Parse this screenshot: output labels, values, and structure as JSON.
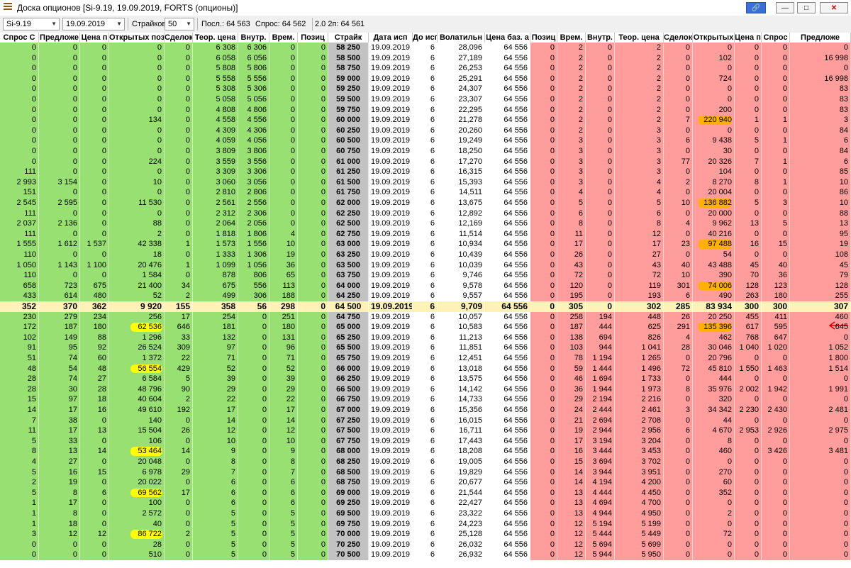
{
  "window": {
    "title": "Доска опционов [Si-9.19, 19.09.2019, FORTS (опционы)]"
  },
  "toolbar": {
    "instrument": "Si-9.19",
    "date": "19.09.2019",
    "strikes_label": "Страйков:",
    "strikes_value": "50",
    "last_label": "Посл.: 64 563",
    "bid_label": "Спрос: 64 562",
    "ask_label": "2.0 2п: 64 561"
  },
  "columns": [
    "Спрос С",
    "Предложе",
    "Цена п",
    "Открытых поз",
    "Сделок",
    "Теор. цена",
    "Внутр.",
    "Врем.",
    "Позиц",
    "Страйк",
    "Дата исп",
    "До исп",
    "Волатильн",
    "Цена баз. а",
    "Позиц",
    "Врем.",
    "Внутр.",
    "Теор. цена",
    "Сделок",
    "Открытых",
    "Цена п",
    "Спрос",
    "Предложе"
  ],
  "rows": [
    [
      "0",
      "0",
      "0",
      "0",
      "0",
      "6 308",
      "6 306",
      "0",
      "0",
      "58 250",
      "19.09.2019",
      "6",
      "28,096",
      "64 556",
      "0",
      "2",
      "0",
      "2",
      "0",
      "0",
      "0",
      "0",
      "0"
    ],
    [
      "0",
      "0",
      "0",
      "0",
      "0",
      "6 058",
      "6 056",
      "0",
      "0",
      "58 500",
      "19.09.2019",
      "6",
      "27,189",
      "64 556",
      "0",
      "2",
      "0",
      "2",
      "0",
      "102",
      "0",
      "0",
      "16 998"
    ],
    [
      "0",
      "0",
      "0",
      "0",
      "0",
      "5 808",
      "5 806",
      "0",
      "0",
      "58 750",
      "19.09.2019",
      "6",
      "26,253",
      "64 556",
      "0",
      "2",
      "0",
      "2",
      "0",
      "0",
      "0",
      "0",
      "0"
    ],
    [
      "0",
      "0",
      "0",
      "0",
      "0",
      "5 558",
      "5 556",
      "0",
      "0",
      "59 000",
      "19.09.2019",
      "6",
      "25,291",
      "64 556",
      "0",
      "2",
      "0",
      "2",
      "0",
      "724",
      "0",
      "0",
      "16 998"
    ],
    [
      "0",
      "0",
      "0",
      "0",
      "0",
      "5 308",
      "5 306",
      "0",
      "0",
      "59 250",
      "19.09.2019",
      "6",
      "24,307",
      "64 556",
      "0",
      "2",
      "0",
      "2",
      "0",
      "0",
      "0",
      "0",
      "83"
    ],
    [
      "0",
      "0",
      "0",
      "0",
      "0",
      "5 058",
      "5 056",
      "0",
      "0",
      "59 500",
      "19.09.2019",
      "6",
      "23,307",
      "64 556",
      "0",
      "2",
      "0",
      "2",
      "0",
      "0",
      "0",
      "0",
      "83"
    ],
    [
      "0",
      "0",
      "0",
      "0",
      "0",
      "4 808",
      "4 806",
      "0",
      "0",
      "59 750",
      "19.09.2019",
      "6",
      "22,295",
      "64 556",
      "0",
      "2",
      "0",
      "2",
      "0",
      "200",
      "0",
      "0",
      "83"
    ],
    [
      "0",
      "0",
      "0",
      "134",
      "0",
      "4 558",
      "4 556",
      "0",
      "0",
      "60 000",
      "19.09.2019",
      "6",
      "21,278",
      "64 556",
      "0",
      "2",
      "0",
      "2",
      "7",
      "220 940",
      "1",
      "1",
      "3"
    ],
    [
      "0",
      "0",
      "0",
      "0",
      "0",
      "4 309",
      "4 306",
      "0",
      "0",
      "60 250",
      "19.09.2019",
      "6",
      "20,260",
      "64 556",
      "0",
      "2",
      "0",
      "3",
      "0",
      "0",
      "0",
      "0",
      "84"
    ],
    [
      "0",
      "0",
      "0",
      "0",
      "0",
      "4 059",
      "4 056",
      "0",
      "0",
      "60 500",
      "19.09.2019",
      "6",
      "19,249",
      "64 556",
      "0",
      "3",
      "0",
      "3",
      "6",
      "9 438",
      "5",
      "1",
      "6"
    ],
    [
      "0",
      "0",
      "0",
      "0",
      "0",
      "3 809",
      "3 806",
      "0",
      "0",
      "60 750",
      "19.09.2019",
      "6",
      "18,250",
      "64 556",
      "0",
      "3",
      "0",
      "3",
      "0",
      "30",
      "0",
      "0",
      "84"
    ],
    [
      "0",
      "0",
      "0",
      "224",
      "0",
      "3 559",
      "3 556",
      "0",
      "0",
      "61 000",
      "19.09.2019",
      "6",
      "17,270",
      "64 556",
      "0",
      "3",
      "0",
      "3",
      "77",
      "20 326",
      "7",
      "1",
      "6"
    ],
    [
      "111",
      "0",
      "0",
      "0",
      "0",
      "3 309",
      "3 306",
      "0",
      "0",
      "61 250",
      "19.09.2019",
      "6",
      "16,315",
      "64 556",
      "0",
      "3",
      "0",
      "3",
      "0",
      "104",
      "0",
      "0",
      "85"
    ],
    [
      "2 993",
      "3 154",
      "0",
      "10",
      "0",
      "3 060",
      "3 056",
      "0",
      "0",
      "61 500",
      "19.09.2019",
      "6",
      "15,393",
      "64 556",
      "0",
      "3",
      "0",
      "4",
      "2",
      "8 270",
      "8",
      "1",
      "10"
    ],
    [
      "151",
      "0",
      "0",
      "0",
      "0",
      "2 810",
      "2 806",
      "0",
      "0",
      "61 750",
      "19.09.2019",
      "6",
      "14,511",
      "64 556",
      "0",
      "4",
      "0",
      "4",
      "0",
      "20 004",
      "0",
      "0",
      "86"
    ],
    [
      "2 545",
      "2 595",
      "0",
      "11 530",
      "0",
      "2 561",
      "2 556",
      "0",
      "0",
      "62 000",
      "19.09.2019",
      "6",
      "13,675",
      "64 556",
      "0",
      "5",
      "0",
      "5",
      "10",
      "136 882",
      "5",
      "3",
      "10"
    ],
    [
      "111",
      "0",
      "0",
      "0",
      "0",
      "2 312",
      "2 306",
      "0",
      "0",
      "62 250",
      "19.09.2019",
      "6",
      "12,892",
      "64 556",
      "0",
      "6",
      "0",
      "6",
      "0",
      "20 000",
      "0",
      "0",
      "88"
    ],
    [
      "2 037",
      "2 136",
      "0",
      "88",
      "0",
      "2 064",
      "2 056",
      "0",
      "0",
      "62 500",
      "19.09.2019",
      "6",
      "12,169",
      "64 556",
      "0",
      "8",
      "0",
      "8",
      "4",
      "9 962",
      "13",
      "5",
      "13"
    ],
    [
      "111",
      "0",
      "0",
      "2",
      "0",
      "1 818",
      "1 806",
      "4",
      "0",
      "62 750",
      "19.09.2019",
      "6",
      "11,514",
      "64 556",
      "0",
      "11",
      "0",
      "12",
      "0",
      "40 216",
      "0",
      "0",
      "95"
    ],
    [
      "1 555",
      "1 612",
      "1 537",
      "42 338",
      "1",
      "1 573",
      "1 556",
      "10",
      "0",
      "63 000",
      "19.09.2019",
      "6",
      "10,934",
      "64 556",
      "0",
      "17",
      "0",
      "17",
      "23",
      "97 488",
      "16",
      "15",
      "19"
    ],
    [
      "110",
      "0",
      "0",
      "18",
      "0",
      "1 333",
      "1 306",
      "19",
      "0",
      "63 250",
      "19.09.2019",
      "6",
      "10,439",
      "64 556",
      "0",
      "26",
      "0",
      "27",
      "0",
      "54",
      "0",
      "0",
      "108"
    ],
    [
      "1 050",
      "1 143",
      "1 100",
      "20 476",
      "1",
      "1 099",
      "1 056",
      "36",
      "0",
      "63 500",
      "19.09.2019",
      "6",
      "10,039",
      "64 556",
      "0",
      "43",
      "0",
      "43",
      "40",
      "43 488",
      "45",
      "40",
      "45"
    ],
    [
      "110",
      "0",
      "0",
      "1 584",
      "0",
      "878",
      "806",
      "65",
      "0",
      "63 750",
      "19.09.2019",
      "6",
      "9,746",
      "64 556",
      "0",
      "72",
      "0",
      "72",
      "10",
      "390",
      "70",
      "36",
      "79"
    ],
    [
      "658",
      "723",
      "675",
      "21 400",
      "34",
      "675",
      "556",
      "113",
      "0",
      "64 000",
      "19.09.2019",
      "6",
      "9,578",
      "64 556",
      "0",
      "120",
      "0",
      "119",
      "301",
      "74 006",
      "128",
      "123",
      "128"
    ],
    [
      "433",
      "614",
      "480",
      "52",
      "2",
      "499",
      "306",
      "188",
      "0",
      "64 250",
      "19.09.2019",
      "6",
      "9,557",
      "64 556",
      "0",
      "195",
      "0",
      "193",
      "6",
      "490",
      "263",
      "180",
      "255"
    ],
    [
      "352",
      "370",
      "362",
      "9 920",
      "155",
      "358",
      "56",
      "298",
      "0",
      "64 500",
      "19.09.2019",
      "6",
      "9,709",
      "64 556",
      "0",
      "305",
      "0",
      "302",
      "285",
      "83 934",
      "300",
      "300",
      "307"
    ],
    [
      "230",
      "279",
      "234",
      "256",
      "17",
      "254",
      "0",
      "251",
      "0",
      "64 750",
      "19.09.2019",
      "6",
      "10,057",
      "64 556",
      "0",
      "258",
      "194",
      "448",
      "26",
      "20 250",
      "455",
      "411",
      "460"
    ],
    [
      "172",
      "187",
      "180",
      "62 536",
      "646",
      "181",
      "0",
      "180",
      "0",
      "65 000",
      "19.09.2019",
      "6",
      "10,583",
      "64 556",
      "0",
      "187",
      "444",
      "625",
      "291",
      "135 396",
      "617",
      "595",
      "645"
    ],
    [
      "102",
      "149",
      "88",
      "1 296",
      "33",
      "132",
      "0",
      "131",
      "0",
      "65 250",
      "19.09.2019",
      "6",
      "11,213",
      "64 556",
      "0",
      "138",
      "694",
      "826",
      "4",
      "462",
      "768",
      "647",
      "0"
    ],
    [
      "91",
      "95",
      "92",
      "26 524",
      "309",
      "97",
      "0",
      "96",
      "0",
      "65 500",
      "19.09.2019",
      "6",
      "11,851",
      "64 556",
      "0",
      "103",
      "944",
      "1 041",
      "28",
      "30 046",
      "1 040",
      "1 020",
      "1 052"
    ],
    [
      "51",
      "74",
      "60",
      "1 372",
      "22",
      "71",
      "0",
      "71",
      "0",
      "65 750",
      "19.09.2019",
      "6",
      "12,451",
      "64 556",
      "0",
      "78",
      "1 194",
      "1 265",
      "0",
      "20 796",
      "0",
      "0",
      "1 800"
    ],
    [
      "48",
      "54",
      "48",
      "56 554",
      "429",
      "52",
      "0",
      "52",
      "0",
      "66 000",
      "19.09.2019",
      "6",
      "13,018",
      "64 556",
      "0",
      "59",
      "1 444",
      "1 496",
      "72",
      "45 810",
      "1 550",
      "1 463",
      "1 514"
    ],
    [
      "28",
      "74",
      "27",
      "6 584",
      "5",
      "39",
      "0",
      "39",
      "0",
      "66 250",
      "19.09.2019",
      "6",
      "13,575",
      "64 556",
      "0",
      "46",
      "1 694",
      "1 733",
      "0",
      "444",
      "0",
      "0",
      "0"
    ],
    [
      "28",
      "30",
      "28",
      "48 796",
      "90",
      "29",
      "0",
      "29",
      "0",
      "66 500",
      "19.09.2019",
      "6",
      "14,142",
      "64 556",
      "0",
      "36",
      "1 944",
      "1 973",
      "8",
      "35 976",
      "2 002",
      "1 942",
      "1 991"
    ],
    [
      "15",
      "97",
      "18",
      "40 604",
      "2",
      "22",
      "0",
      "22",
      "0",
      "66 750",
      "19.09.2019",
      "6",
      "14,733",
      "64 556",
      "0",
      "29",
      "2 194",
      "2 216",
      "0",
      "320",
      "0",
      "0",
      "0"
    ],
    [
      "14",
      "17",
      "16",
      "49 610",
      "192",
      "17",
      "0",
      "17",
      "0",
      "67 000",
      "19.09.2019",
      "6",
      "15,356",
      "64 556",
      "0",
      "24",
      "2 444",
      "2 461",
      "3",
      "34 342",
      "2 230",
      "2 430",
      "2 481"
    ],
    [
      "7",
      "38",
      "0",
      "140",
      "0",
      "14",
      "0",
      "14",
      "0",
      "67 250",
      "19.09.2019",
      "6",
      "16,015",
      "64 556",
      "0",
      "21",
      "2 694",
      "2 708",
      "0",
      "44",
      "0",
      "0",
      "0"
    ],
    [
      "11",
      "17",
      "13",
      "15 504",
      "26",
      "12",
      "0",
      "12",
      "0",
      "67 500",
      "19.09.2019",
      "6",
      "16,711",
      "64 556",
      "0",
      "19",
      "2 944",
      "2 956",
      "6",
      "4 670",
      "2 953",
      "2 926",
      "2 975"
    ],
    [
      "5",
      "33",
      "0",
      "106",
      "0",
      "10",
      "0",
      "10",
      "0",
      "67 750",
      "19.09.2019",
      "6",
      "17,443",
      "64 556",
      "0",
      "17",
      "3 194",
      "3 204",
      "0",
      "8",
      "0",
      "0",
      "0"
    ],
    [
      "8",
      "13",
      "14",
      "53 464",
      "14",
      "9",
      "0",
      "9",
      "0",
      "68 000",
      "19.09.2019",
      "6",
      "18,208",
      "64 556",
      "0",
      "16",
      "3 444",
      "3 453",
      "0",
      "460",
      "0",
      "3 426",
      "3 481"
    ],
    [
      "4",
      "27",
      "0",
      "20 048",
      "0",
      "8",
      "0",
      "8",
      "0",
      "68 250",
      "19.09.2019",
      "6",
      "19,005",
      "64 556",
      "0",
      "15",
      "3 694",
      "3 702",
      "0",
      "0",
      "0",
      "0",
      "0"
    ],
    [
      "5",
      "16",
      "15",
      "6 978",
      "29",
      "7",
      "0",
      "7",
      "0",
      "68 500",
      "19.09.2019",
      "6",
      "19,829",
      "64 556",
      "0",
      "14",
      "3 944",
      "3 951",
      "0",
      "270",
      "0",
      "0",
      "0"
    ],
    [
      "2",
      "19",
      "0",
      "20 022",
      "0",
      "6",
      "0",
      "6",
      "0",
      "68 750",
      "19.09.2019",
      "6",
      "20,677",
      "64 556",
      "0",
      "14",
      "4 194",
      "4 200",
      "0",
      "60",
      "0",
      "0",
      "0"
    ],
    [
      "5",
      "8",
      "6",
      "69 562",
      "17",
      "6",
      "0",
      "6",
      "0",
      "69 000",
      "19.09.2019",
      "6",
      "21,544",
      "64 556",
      "0",
      "13",
      "4 444",
      "4 450",
      "0",
      "352",
      "0",
      "0",
      "0"
    ],
    [
      "1",
      "17",
      "0",
      "100",
      "0",
      "6",
      "0",
      "6",
      "0",
      "69 250",
      "19.09.2019",
      "6",
      "22,427",
      "64 556",
      "0",
      "13",
      "4 694",
      "4 700",
      "0",
      "0",
      "0",
      "0",
      "0"
    ],
    [
      "1",
      "8",
      "0",
      "2 572",
      "0",
      "5",
      "0",
      "5",
      "0",
      "69 500",
      "19.09.2019",
      "6",
      "23,322",
      "64 556",
      "0",
      "13",
      "4 944",
      "4 950",
      "0",
      "2",
      "0",
      "0",
      "0"
    ],
    [
      "1",
      "18",
      "0",
      "40",
      "0",
      "5",
      "0",
      "5",
      "0",
      "69 750",
      "19.09.2019",
      "6",
      "24,223",
      "64 556",
      "0",
      "12",
      "5 194",
      "5 199",
      "0",
      "0",
      "0",
      "0",
      "0"
    ],
    [
      "3",
      "12",
      "12",
      "86 722",
      "2",
      "5",
      "0",
      "5",
      "0",
      "70 000",
      "19.09.2019",
      "6",
      "25,128",
      "64 556",
      "0",
      "12",
      "5 444",
      "5 449",
      "0",
      "72",
      "0",
      "0",
      "0"
    ],
    [
      "0",
      "0",
      "0",
      "28",
      "0",
      "5",
      "0",
      "5",
      "0",
      "70 250",
      "19.09.2019",
      "6",
      "26,032",
      "64 556",
      "0",
      "12",
      "5 694",
      "5 699",
      "0",
      "0",
      "0",
      "0",
      "0"
    ],
    [
      "0",
      "0",
      "0",
      "510",
      "0",
      "5",
      "0",
      "5",
      "0",
      "70 500",
      "19.09.2019",
      "6",
      "26,932",
      "64 556",
      "0",
      "12",
      "5 944",
      "5 950",
      "0",
      "0",
      "0",
      "0",
      "0"
    ]
  ],
  "highlights": {
    "atm_row": 25,
    "call_oi_yellow_rows": [
      27,
      31,
      39,
      43,
      47
    ],
    "put_oi_orange_rows": [
      7,
      15,
      19,
      23,
      27
    ]
  },
  "colors": {
    "call_bg": "#98e072",
    "put_bg": "#ff9d9d",
    "strike_bg": "#c2c2c2",
    "atm_bg": "#fff2b6",
    "marker_yellow": "#ffff00",
    "marker_orange": "#ffb000",
    "arrow_red": "#d40000"
  },
  "icons": {
    "app": "table-icon",
    "link": "link-icon",
    "minimize": "minimize-icon",
    "maximize": "maximize-icon",
    "close": "close-icon",
    "annotation": "red-arrow-icon"
  }
}
